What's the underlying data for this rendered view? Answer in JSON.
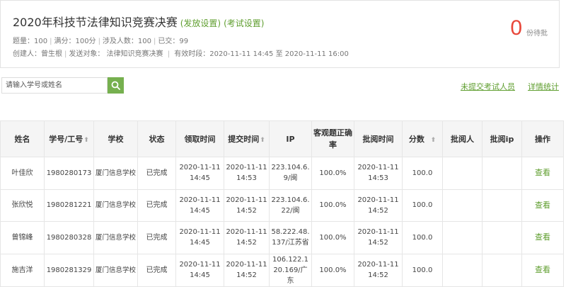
{
  "header": {
    "title": "2020年科技节法律知识竞赛决赛",
    "publish_link": "(发放设置)",
    "exam_link": "(考试设置)",
    "meta1": [
      "题量：100",
      "满分：100分",
      "涉及人数：100",
      "已交：99"
    ],
    "meta2": [
      "创建人：曾生根",
      "发送对象：  法律知识竞赛决赛"
    ],
    "meta2_time": "有效时段：2020-11-11 14:45 至 2020-11-11 16:00",
    "pending_count": "0",
    "pending_label": "份待批"
  },
  "search": {
    "placeholder": "请输入学号或姓名",
    "value": ""
  },
  "links": {
    "unsubmitted": "未提交考试人员",
    "details": "详情统计"
  },
  "table": {
    "headers": [
      "姓名",
      "学号/工号",
      "学校",
      "状态",
      "领取时间",
      "提交时间",
      "IP",
      "客观题正确率",
      "批阅时间",
      "分数",
      "批阅人",
      "批阅ip",
      "操作"
    ],
    "rows": [
      {
        "name": "叶佳欣",
        "id": "1980280173",
        "school": "厦门信息学校",
        "status": "已完成",
        "recv_date": "2020-11-11",
        "recv_time": "14:45",
        "sub_date": "2020-11-11",
        "sub_time": "14:53",
        "ip": "223.104.6.9/闽",
        "rate": "100.0%",
        "rev_date": "2020-11-11",
        "rev_time": "14:53",
        "score": "100.0",
        "reviewer": "",
        "reviewer_ip": "",
        "action": "查看"
      },
      {
        "name": "张欣悦",
        "id": "1980281221",
        "school": "厦门信息学校",
        "status": "已完成",
        "recv_date": "2020-11-11",
        "recv_time": "14:45",
        "sub_date": "2020-11-11",
        "sub_time": "14:52",
        "ip": "223.104.6.22/闽",
        "rate": "100.0%",
        "rev_date": "2020-11-11",
        "rev_time": "14:52",
        "score": "100.0",
        "reviewer": "",
        "reviewer_ip": "",
        "action": "查看"
      },
      {
        "name": "曾锦峰",
        "id": "1980280328",
        "school": "厦门信息学校",
        "status": "已完成",
        "recv_date": "2020-11-11",
        "recv_time": "14:45",
        "sub_date": "2020-11-11",
        "sub_time": "14:52",
        "ip": "58.222.48.137/江苏省",
        "rate": "100.0%",
        "rev_date": "2020-11-11",
        "rev_time": "14:52",
        "score": "100.0",
        "reviewer": "",
        "reviewer_ip": "",
        "action": "查看"
      },
      {
        "name": "施吉洋",
        "id": "1980281329",
        "school": "厦门信息学校",
        "status": "已完成",
        "recv_date": "2020-11-11",
        "recv_time": "14:45",
        "sub_date": "2020-11-11",
        "sub_time": "14:52",
        "ip": "106.122.120.169/广东",
        "rate": "100.0%",
        "rev_date": "2020-11-11",
        "rev_time": "14:52",
        "score": "100.0",
        "reviewer": "",
        "reviewer_ip": "",
        "action": "查看"
      }
    ]
  }
}
